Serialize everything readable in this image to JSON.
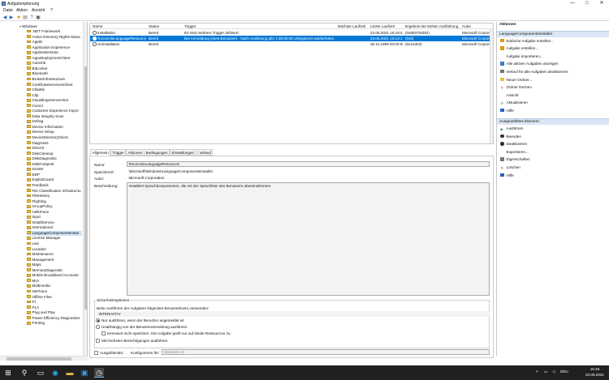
{
  "window": {
    "title": "Aufgabenplanung",
    "controls": {
      "minimize": "—",
      "maximize": "□",
      "close": "✕"
    }
  },
  "menu": [
    "Datei",
    "Aktion",
    "Ansicht",
    "?"
  ],
  "toolbar": {
    "icons": [
      "back-arrow-icon",
      "forward-arrow-icon",
      "folder-icon",
      "properties-icon",
      "help-icon",
      "panel-icon"
    ]
  },
  "tree": {
    "root": "Windows",
    "items": [
      ".NET Framework",
      "Active Directory Rights Mana",
      "AppID",
      "Application Experience",
      "ApplicationData",
      "AppxDeploymentClient",
      "Autochk",
      "BitLocker",
      "Bluetooth",
      "BrokerInfrastructure",
      "CertificateServicesClient",
      "Chkdsk",
      "Clip",
      "CloudExperienceHost",
      "Concrt",
      "Customer Experience Impro",
      "Data Integrity Scan",
      "Defrag",
      "Device Information",
      "Device Setup",
      "DeviceDirectoryClient",
      "Diagnosis",
      "DirectX",
      "DiskCleanup",
      "DiskDiagnostic",
      "DiskFootprint",
      "DUSM",
      "EDP",
      "ExploitGuard",
      "Feedback",
      "File Classification Infrastructu",
      "FileHistory",
      "Flighting",
      "GroupPolicy",
      "HelloFace",
      "Input",
      "InstallService",
      "International",
      "LanguageComponentsInstal",
      "License Manager",
      "Live",
      "Location",
      "Maintenance",
      "Management",
      "Maps",
      "MemoryDiagnostic",
      "Mobile Broadband Accounts",
      "MUI",
      "Multimedia",
      "NetTrace",
      "Offline Files",
      "PI",
      "PLA",
      "Plug and Play",
      "Power Efficiency Diagnostics",
      "Printing"
    ],
    "selected_index": 38
  },
  "tasklist": {
    "columns": [
      "Name",
      "Status",
      "Trigger",
      "Nächste Laufzeit",
      "Letzte Laufzeit",
      "Ergebnis der letzten Ausführung",
      "Autor"
    ],
    "rows": [
      {
        "name": "Installation",
        "status": "Bereit",
        "trigger": "Es sind mehrere Trigger definiert.",
        "next": "",
        "last": "23.06.2021 16:15:44",
        "result": "(0x800704DD)",
        "author": "Microsoft Corporati"
      },
      {
        "name": "ReconcileLanguageResources",
        "status": "Bereit",
        "trigger": "Bei Anmeldung eines Benutzers - Nach Auslösung alle 1:00:00:00 unbegrenzt wiederholen.",
        "next": "",
        "last": "23.06.2021 15:13:12",
        "result": "(0x0)",
        "author": "Microsoft Corporati"
      },
      {
        "name": "Uninstallation",
        "status": "Bereit",
        "trigger": "",
        "next": "",
        "last": "30.11.1999 00:00:00",
        "result": "(0x41303)",
        "author": "Microsoft Corporati"
      }
    ],
    "selected_row": 1
  },
  "tabs": [
    "Allgemein",
    "Trigger",
    "Aktionen",
    "Bedingungen",
    "Einstellungen",
    "Verlauf"
  ],
  "detail": {
    "name_label": "Name:",
    "name_value": "ReconcileLanguageResources",
    "path_label": "Speicherort:",
    "path_value": "\\Microsoft\\Windows\\LanguageComponentsInstaller",
    "author_label": "Autor:",
    "author_value": "Microsoft Corporation",
    "desc_label": "Beschreibung:",
    "desc_value": "Installiert Sprachkomponenten, die mit der Sprachliste des Benutzers übereinstimmen.",
    "security_title": "Sicherheitsoptionen",
    "run_as_label": "Beim Ausführen der Aufgaben folgendes Benutzerkonto verwenden:",
    "run_as_value": "INTERAKTIV",
    "opt_logged_on": "Nur ausführen, wenn der Benutzer angemeldet ist",
    "opt_any_logon": "Unabhängig von der Benutzeranmeldung ausführen",
    "opt_no_password": "Kennwort nicht speichern. Die Aufgabe greift nur auf lokale Ressourcen zu.",
    "opt_highest": "Mit höchsten Berechtigungen ausführen",
    "hidden_label": "Ausgeblendet",
    "configure_label": "Konfigurieren für:",
    "configure_value": "Windows 10"
  },
  "actions": {
    "header": "Aktionen",
    "section1": "LanguageComponentsInstaller",
    "items1": [
      {
        "label": "Einfache Aufgabe erstellen...",
        "icon": "wand-icon",
        "color": "#d99a1a"
      },
      {
        "label": "Aufgabe erstellen...",
        "icon": "task-icon",
        "color": "#d99a1a"
      },
      {
        "label": "Aufgabe importieren...",
        "icon": "",
        "color": ""
      },
      {
        "label": "Alle aktiven Aufgaben anzeigen",
        "icon": "list-icon",
        "color": "#3a78c8"
      },
      {
        "label": "Verlauf für alle Aufgaben deaktivieren",
        "icon": "history-icon",
        "color": "#777777"
      },
      {
        "label": "Neuer Ordner...",
        "icon": "folder-icon",
        "color": "#e8c040"
      },
      {
        "label": "Ordner löschen",
        "icon": "delete-icon",
        "color": "#d03030"
      },
      {
        "label": "Ansicht",
        "icon": "",
        "color": ""
      },
      {
        "label": "Aktualisieren",
        "icon": "refresh-icon",
        "color": "#2a9a3a"
      },
      {
        "label": "Hilfe",
        "icon": "help-icon",
        "color": "#2a62b8"
      }
    ],
    "section2": "Ausgewähltes Element",
    "items2": [
      {
        "label": "Ausführen",
        "icon": "play-icon",
        "color": "#2a9a3a"
      },
      {
        "label": "Beenden",
        "icon": "stop-icon",
        "color": "#333333"
      },
      {
        "label": "Deaktivieren",
        "icon": "disable-icon",
        "color": "#333333"
      },
      {
        "label": "Exportieren...",
        "icon": "",
        "color": ""
      },
      {
        "label": "Eigenschaften",
        "icon": "properties-icon",
        "color": "#777777"
      },
      {
        "label": "Löschen",
        "icon": "delete-icon",
        "color": "#d03030"
      },
      {
        "label": "Hilfe",
        "icon": "help-icon",
        "color": "#2a62b8"
      }
    ]
  },
  "taskbar": {
    "tray_lang": "DEU",
    "time": "16:46",
    "date": "23.06.2021"
  }
}
